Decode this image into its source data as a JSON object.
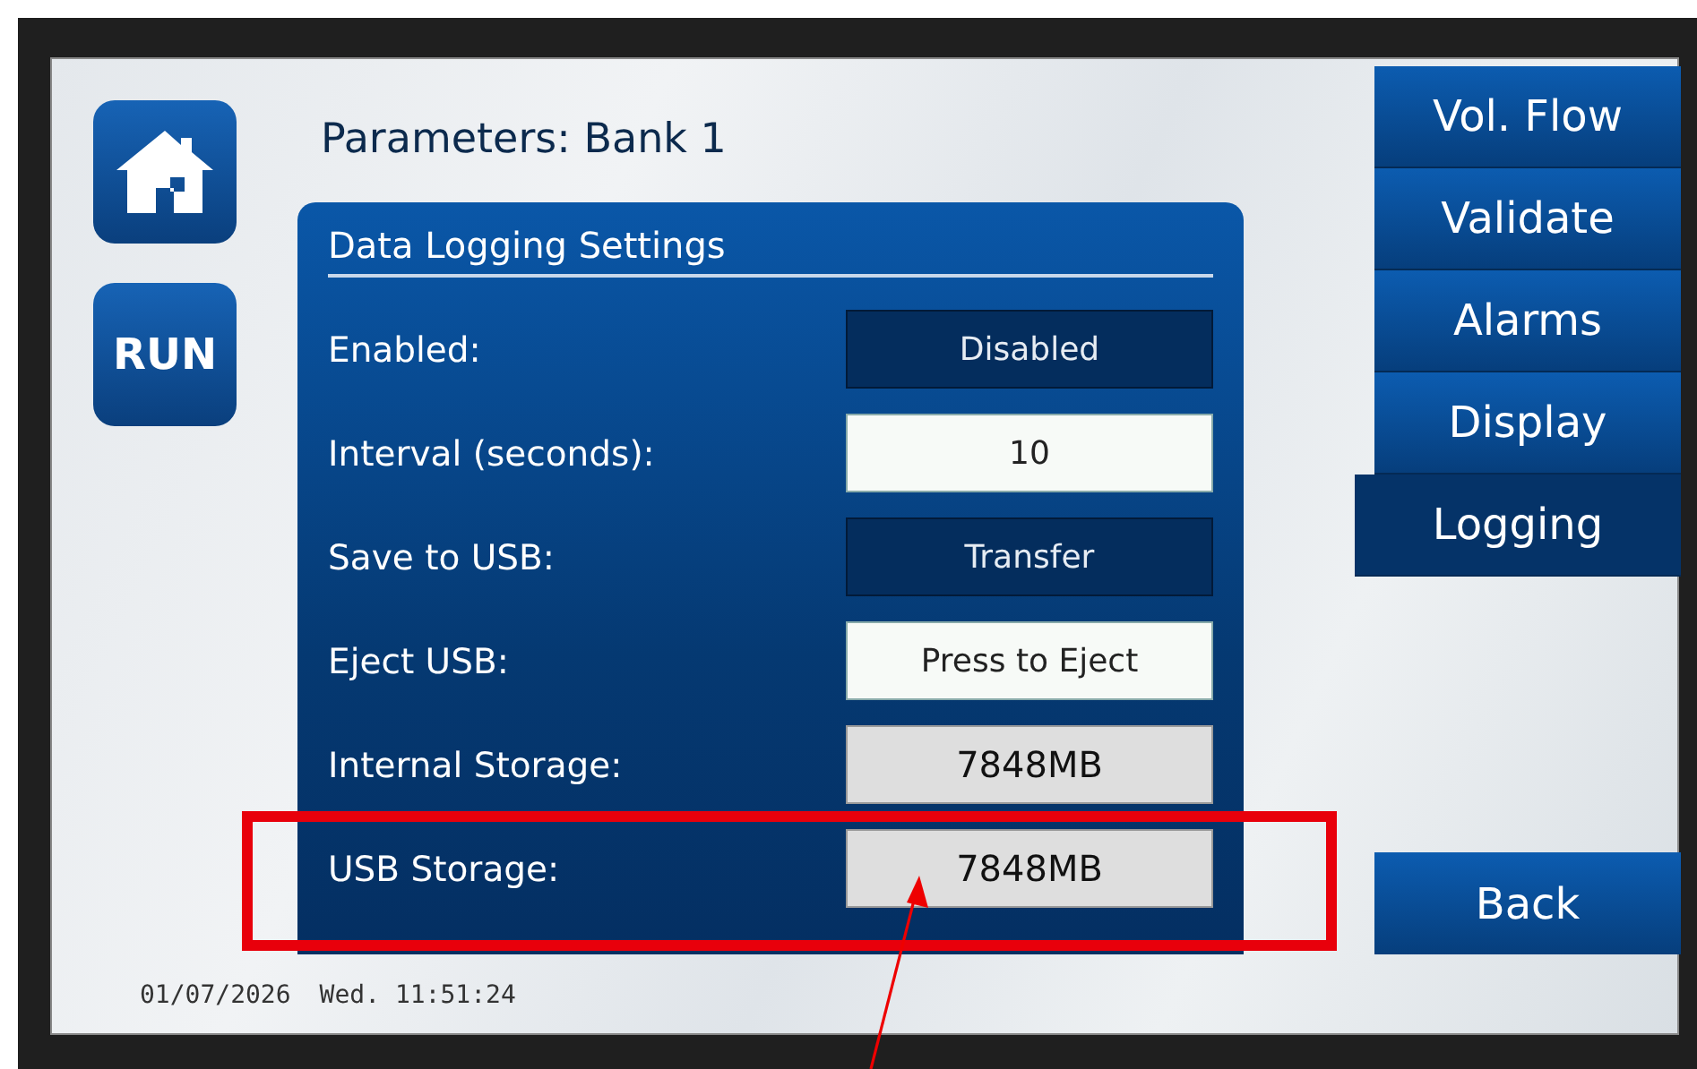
{
  "header": {
    "title": "Parameters: Bank 1"
  },
  "side_buttons": [
    {
      "kind": "home"
    },
    {
      "kind": "run",
      "label": "RUN"
    }
  ],
  "panel": {
    "heading": "Data Logging Settings",
    "rows": [
      {
        "label": "Enabled:",
        "value": "Disabled",
        "kind": "toggle"
      },
      {
        "label": "Interval (seconds):",
        "value": "10",
        "kind": "input"
      },
      {
        "label": "Save to USB:",
        "value": "Transfer",
        "kind": "toggle"
      },
      {
        "label": "Eject USB:",
        "value": "Press to Eject",
        "kind": "input"
      },
      {
        "label": "Internal Storage:",
        "value": "7848MB",
        "kind": "readout"
      },
      {
        "label": "USB Storage:",
        "value": "7848MB",
        "kind": "readout"
      }
    ]
  },
  "nav_tabs": [
    {
      "label": "Vol. Flow",
      "selected": false
    },
    {
      "label": "Validate",
      "selected": false
    },
    {
      "label": "Alarms",
      "selected": false
    },
    {
      "label": "Display",
      "selected": false
    },
    {
      "label": "Logging",
      "selected": true
    }
  ],
  "back_button": {
    "label": "Back"
  },
  "status": {
    "date": "01/07/2026",
    "time": "Wed. 11:51:24"
  }
}
